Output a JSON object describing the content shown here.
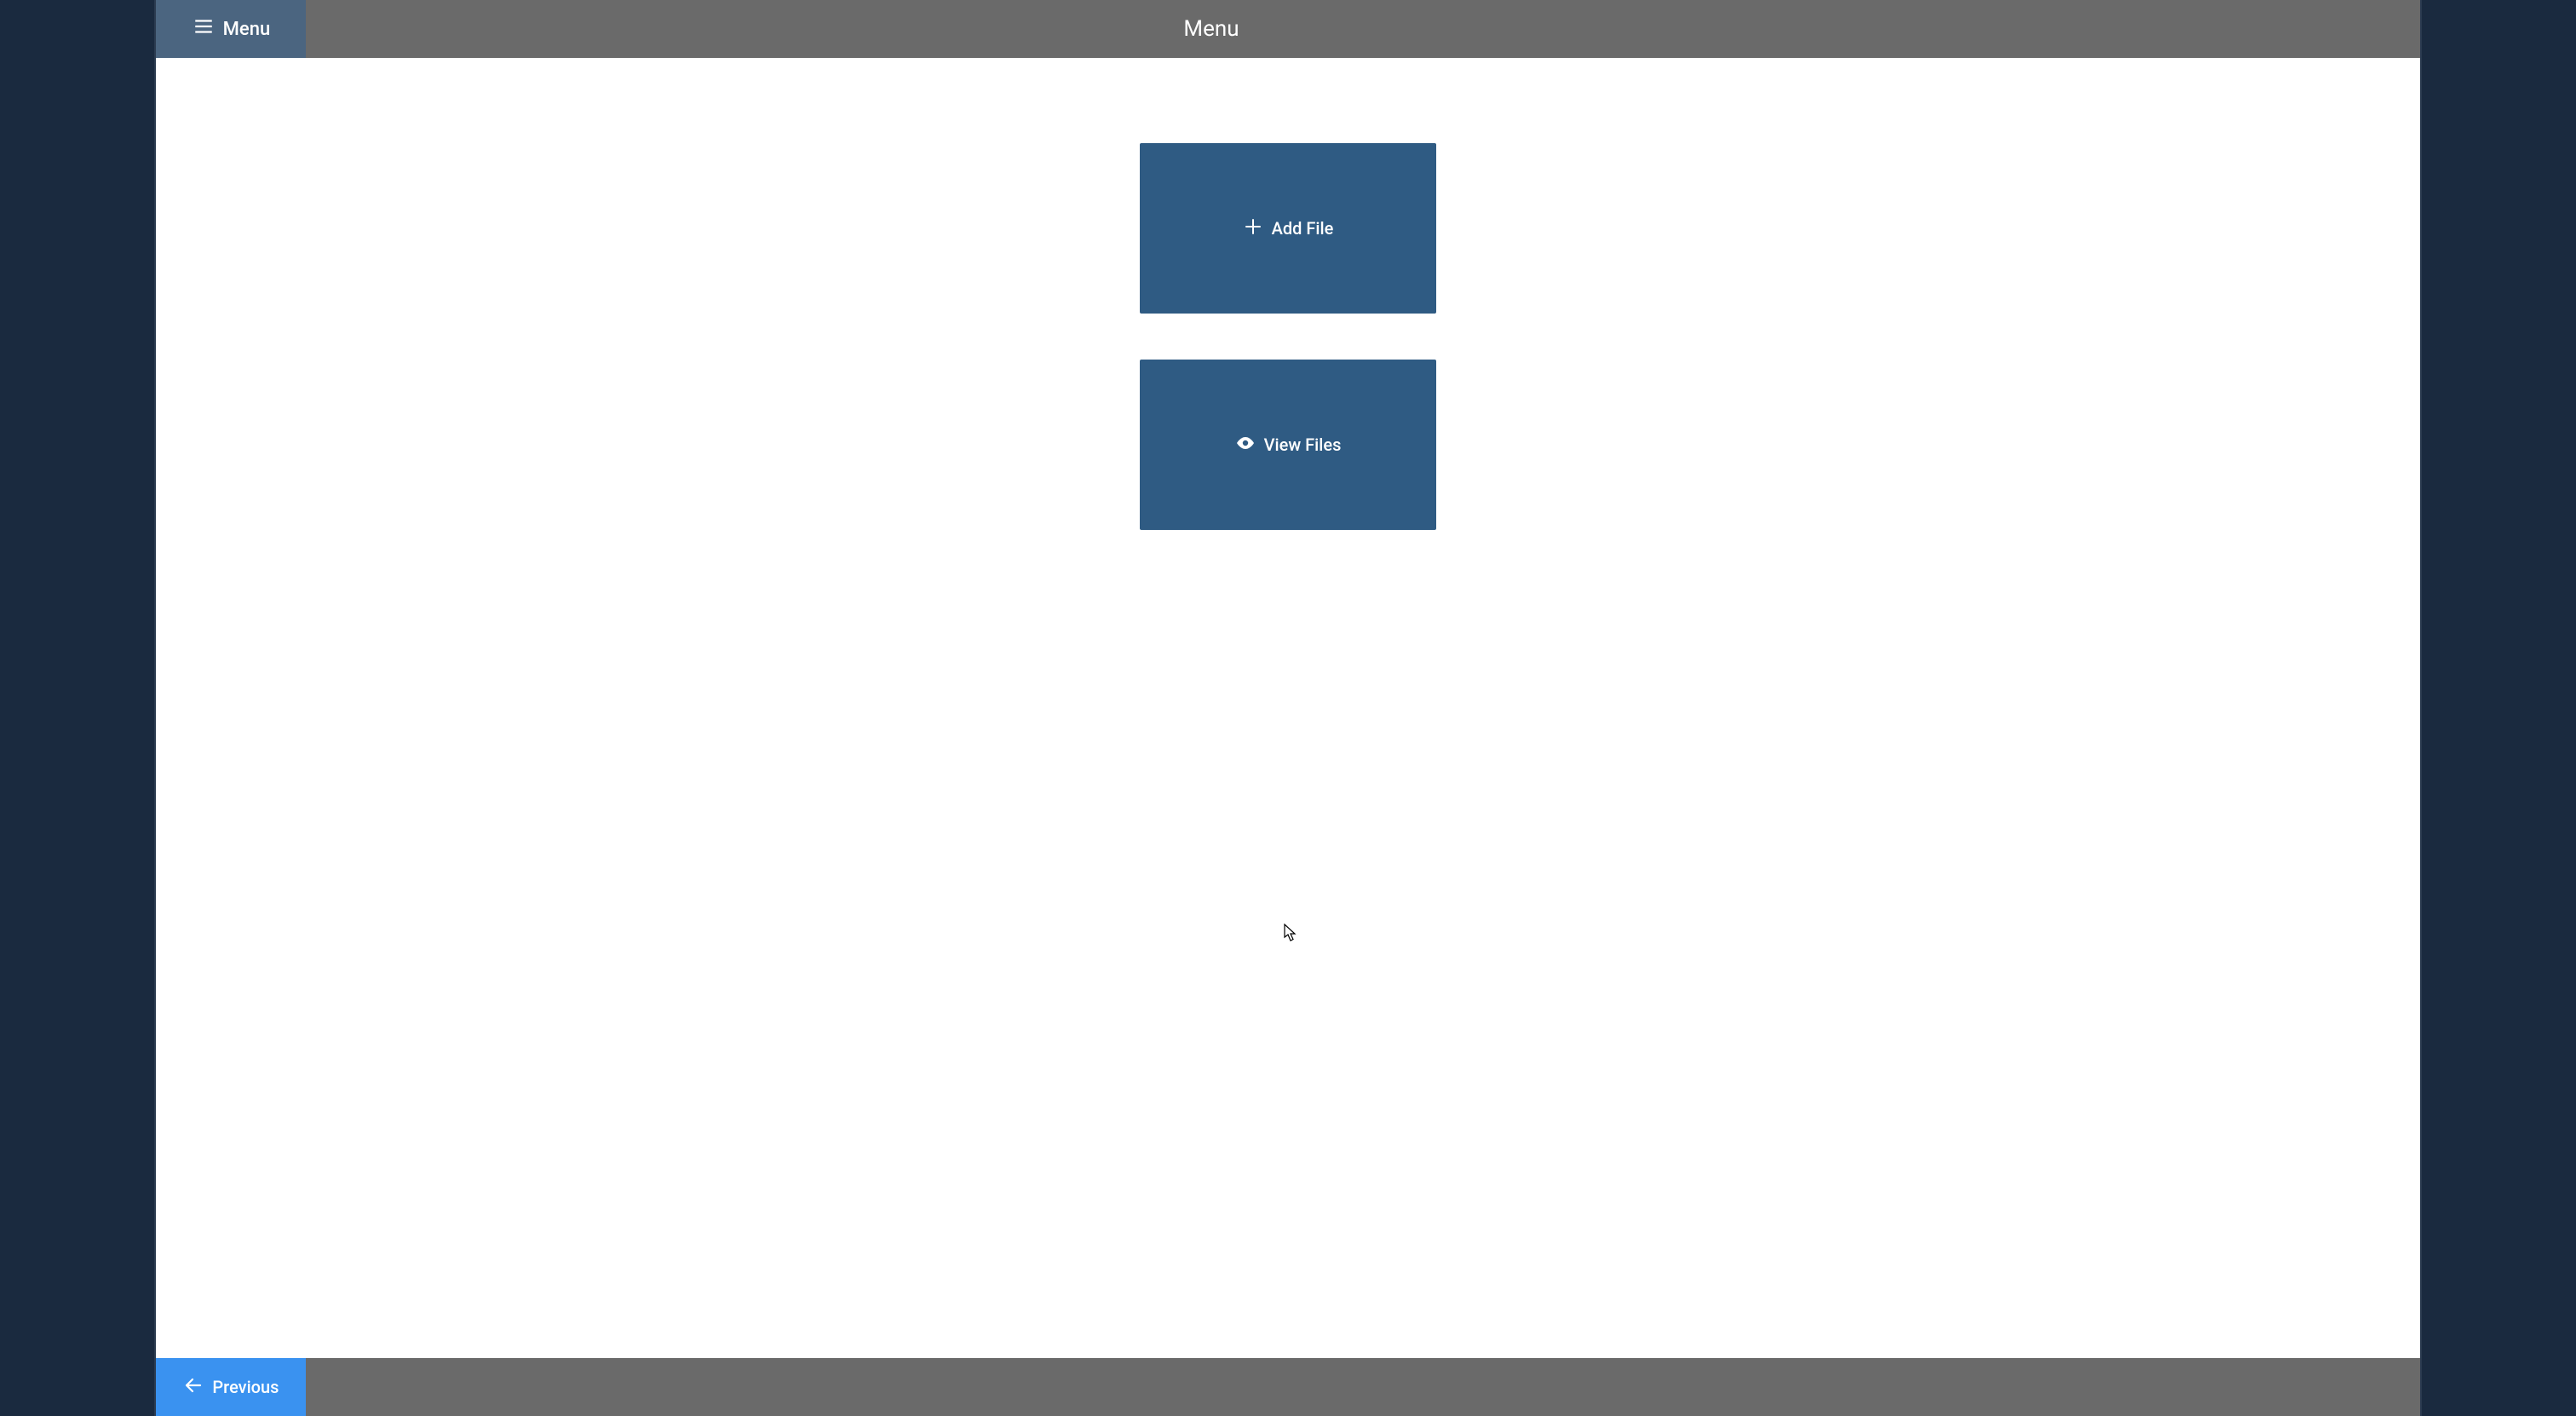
{
  "topbar": {
    "menu_button_label": "Menu",
    "title": "Menu"
  },
  "tiles": {
    "add_file_label": "Add File",
    "view_files_label": "View Files"
  },
  "bottombar": {
    "previous_label": "Previous"
  },
  "icons": {
    "hamburger": "hamburger-icon",
    "plus": "plus-icon",
    "eye": "eye-icon",
    "arrow_left": "arrow-left-icon"
  },
  "colors": {
    "outer_bg": "#1a2a3f",
    "topbar_bg": "#6a6a6a",
    "menu_button_bg": "#4b6580",
    "content_bg": "#ffffff",
    "tile_bg": "#2f5b83",
    "previous_bg": "#3a92f0",
    "text_on_dark": "#ffffff"
  }
}
